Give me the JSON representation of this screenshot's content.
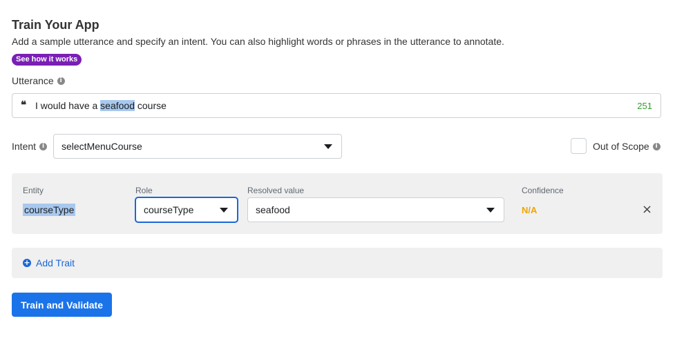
{
  "header": {
    "title": "Train Your App",
    "description": "Add a sample utterance and specify an intent. You can also highlight words or phrases in the utterance to annotate.",
    "help_pill": "See how it works"
  },
  "utterance": {
    "label": "Utterance",
    "quote_icon": "quote-icon",
    "text_before": "I would have a ",
    "highlight": "seafood",
    "text_after": " course",
    "char_count": "251"
  },
  "intent": {
    "label": "Intent",
    "value": "selectMenuCourse",
    "out_of_scope_label": "Out of Scope"
  },
  "entity_table": {
    "headers": {
      "entity": "Entity",
      "role": "Role",
      "resolved": "Resolved value",
      "confidence": "Confidence"
    },
    "row": {
      "entity": "courseType",
      "role": "courseType",
      "resolved": "seafood",
      "confidence": "N/A"
    }
  },
  "add_trait": "Add Trait",
  "train_button": "Train and Validate",
  "colors": {
    "accent": "#1a73e8",
    "pill": "#7a1fb5",
    "highlight": "#a8c8ee",
    "count": "#2e9e2a",
    "na": "#f0a500"
  }
}
